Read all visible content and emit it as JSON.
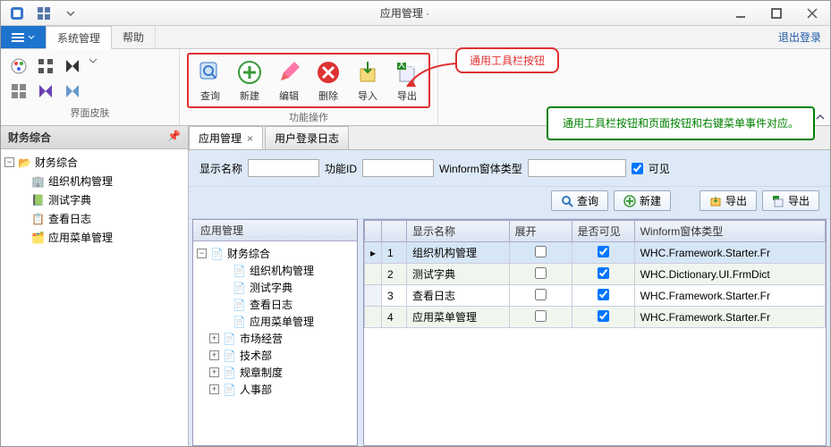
{
  "title": "应用管理 ·",
  "menubar": {
    "tabs": [
      "系统管理",
      "帮助"
    ],
    "logout": "退出登录"
  },
  "ribbon": {
    "group1": {
      "label": "界面皮肤"
    },
    "group2": {
      "label": "功能操作",
      "buttons": [
        {
          "id": "query",
          "label": "查询"
        },
        {
          "id": "new",
          "label": "新建"
        },
        {
          "id": "edit",
          "label": "编辑"
        },
        {
          "id": "delete",
          "label": "删除"
        },
        {
          "id": "import",
          "label": "导入"
        },
        {
          "id": "export",
          "label": "导出"
        }
      ]
    }
  },
  "callout": "通用工具栏按钮",
  "greenbox": "通用工具栏按钮和页面按钮和右键菜单事件对应。",
  "sidebar": {
    "title": "财务综合",
    "root": "财务综合",
    "items": [
      "组织机构管理",
      "测试字典",
      "查看日志",
      "应用菜单管理"
    ]
  },
  "doctabs": [
    "应用管理",
    "用户登录日志"
  ],
  "filter": {
    "lblName": "显示名称",
    "lblFunc": "功能ID",
    "lblWin": "Winform窗体类型",
    "lblVisible": "可见",
    "valName": "",
    "valFunc": "",
    "valWin": "",
    "checked": true
  },
  "pagebtns": {
    "query": "查询",
    "new": "新建",
    "export1": "导出",
    "export2": "导出"
  },
  "tree2": {
    "header": "应用管理",
    "root": "财务综合",
    "groupA": [
      "组织机构管理",
      "测试字典",
      "查看日志",
      "应用菜单管理"
    ],
    "rest": [
      "市场经营",
      "技术部",
      "规章制度",
      "人事部"
    ]
  },
  "grid": {
    "cols": [
      "",
      "显示名称",
      "展开",
      "是否可见",
      "Winform窗体类型"
    ],
    "rows": [
      {
        "n": "1",
        "name": "组织机构管理",
        "expand": false,
        "visible": true,
        "win": "WHC.Framework.Starter.Fr"
      },
      {
        "n": "2",
        "name": "测试字典",
        "expand": false,
        "visible": true,
        "win": "WHC.Dictionary.UI.FrmDict"
      },
      {
        "n": "3",
        "name": "查看日志",
        "expand": false,
        "visible": true,
        "win": "WHC.Framework.Starter.Fr"
      },
      {
        "n": "4",
        "name": "应用菜单管理",
        "expand": false,
        "visible": true,
        "win": "WHC.Framework.Starter.Fr"
      }
    ]
  }
}
